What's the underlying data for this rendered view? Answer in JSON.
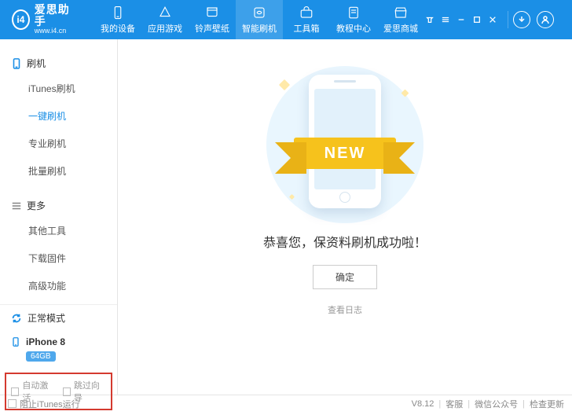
{
  "app": {
    "logo_text": "i4",
    "name": "爱思助手",
    "site": "www.i4.cn"
  },
  "topnav": [
    {
      "label": "我的设备",
      "icon": "device"
    },
    {
      "label": "应用游戏",
      "icon": "apps"
    },
    {
      "label": "铃声壁纸",
      "icon": "music"
    },
    {
      "label": "智能刷机",
      "icon": "flash",
      "active": true
    },
    {
      "label": "工具箱",
      "icon": "toolbox"
    },
    {
      "label": "教程中心",
      "icon": "docs"
    },
    {
      "label": "爱思商城",
      "icon": "store"
    }
  ],
  "sidebar": {
    "group_flash": {
      "title": "刷机",
      "items": [
        "iTunes刷机",
        "一键刷机",
        "专业刷机",
        "批量刷机"
      ],
      "active_index": 1
    },
    "group_more": {
      "title": "更多",
      "items": [
        "其他工具",
        "下载固件",
        "高级功能"
      ]
    },
    "mode": "正常模式",
    "device": {
      "name": "iPhone 8",
      "storage": "64GB"
    },
    "checks": {
      "auto_activate": "自动激活",
      "skip_guide": "跳过向导"
    }
  },
  "main": {
    "ribbon": "NEW",
    "success": "恭喜您，保资料刷机成功啦！",
    "ok": "确定",
    "view_log": "查看日志"
  },
  "statusbar": {
    "block_itunes": "阻止iTunes运行",
    "version": "V8.12",
    "support": "客服",
    "wechat": "微信公众号",
    "update": "检查更新"
  }
}
